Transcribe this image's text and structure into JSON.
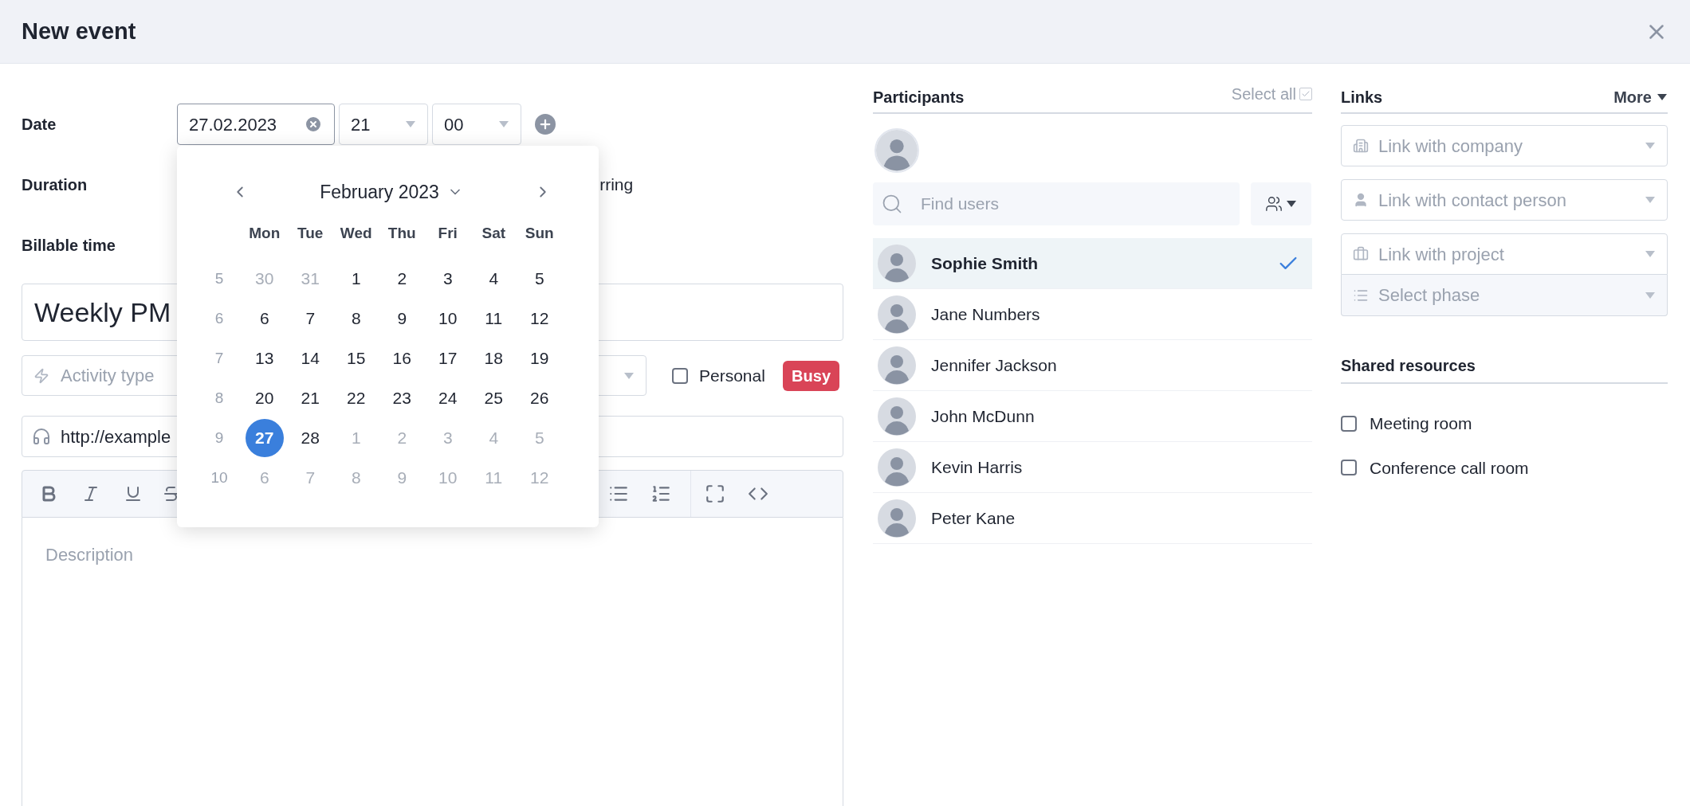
{
  "window": {
    "title": "New event"
  },
  "form": {
    "date_label": "Date",
    "date_value": "27.02.2023",
    "hour": "21",
    "minute": "00",
    "duration_label": "Duration",
    "recurring_fragment": "rring",
    "billable_label": "Billable time",
    "title_value": "Weekly PM",
    "activity_placeholder": "Activity type",
    "personal": {
      "label": "Personal",
      "checked": false
    },
    "busy_badge": "Busy",
    "url_value": "http://example",
    "description_placeholder": "Description"
  },
  "calendar": {
    "month": "February 2023",
    "weekdays": [
      "Mon",
      "Tue",
      "Wed",
      "Thu",
      "Fri",
      "Sat",
      "Sun"
    ],
    "weeks": [
      {
        "number": "5",
        "days": [
          {
            "text": "30",
            "muted": true,
            "selected": false
          },
          {
            "text": "31",
            "muted": true,
            "selected": false
          },
          {
            "text": "1",
            "muted": false,
            "selected": false
          },
          {
            "text": "2",
            "muted": false,
            "selected": false
          },
          {
            "text": "3",
            "muted": false,
            "selected": false
          },
          {
            "text": "4",
            "muted": false,
            "selected": false
          },
          {
            "text": "5",
            "muted": false,
            "selected": false
          }
        ]
      },
      {
        "number": "6",
        "days": [
          {
            "text": "6",
            "muted": false,
            "selected": false
          },
          {
            "text": "7",
            "muted": false,
            "selected": false
          },
          {
            "text": "8",
            "muted": false,
            "selected": false
          },
          {
            "text": "9",
            "muted": false,
            "selected": false
          },
          {
            "text": "10",
            "muted": false,
            "selected": false
          },
          {
            "text": "11",
            "muted": false,
            "selected": false
          },
          {
            "text": "12",
            "muted": false,
            "selected": false
          }
        ]
      },
      {
        "number": "7",
        "days": [
          {
            "text": "13",
            "muted": false,
            "selected": false
          },
          {
            "text": "14",
            "muted": false,
            "selected": false
          },
          {
            "text": "15",
            "muted": false,
            "selected": false
          },
          {
            "text": "16",
            "muted": false,
            "selected": false
          },
          {
            "text": "17",
            "muted": false,
            "selected": false
          },
          {
            "text": "18",
            "muted": false,
            "selected": false
          },
          {
            "text": "19",
            "muted": false,
            "selected": false
          }
        ]
      },
      {
        "number": "8",
        "days": [
          {
            "text": "20",
            "muted": false,
            "selected": false
          },
          {
            "text": "21",
            "muted": false,
            "selected": false
          },
          {
            "text": "22",
            "muted": false,
            "selected": false
          },
          {
            "text": "23",
            "muted": false,
            "selected": false
          },
          {
            "text": "24",
            "muted": false,
            "selected": false
          },
          {
            "text": "25",
            "muted": false,
            "selected": false
          },
          {
            "text": "26",
            "muted": false,
            "selected": false
          }
        ]
      },
      {
        "number": "9",
        "days": [
          {
            "text": "27",
            "muted": false,
            "selected": true
          },
          {
            "text": "28",
            "muted": false,
            "selected": false
          },
          {
            "text": "1",
            "muted": true,
            "selected": false
          },
          {
            "text": "2",
            "muted": true,
            "selected": false
          },
          {
            "text": "3",
            "muted": true,
            "selected": false
          },
          {
            "text": "4",
            "muted": true,
            "selected": false
          },
          {
            "text": "5",
            "muted": true,
            "selected": false
          }
        ]
      },
      {
        "number": "10",
        "days": [
          {
            "text": "6",
            "muted": true,
            "selected": false
          },
          {
            "text": "7",
            "muted": true,
            "selected": false
          },
          {
            "text": "8",
            "muted": true,
            "selected": false
          },
          {
            "text": "9",
            "muted": true,
            "selected": false
          },
          {
            "text": "10",
            "muted": true,
            "selected": false
          },
          {
            "text": "11",
            "muted": true,
            "selected": false
          },
          {
            "text": "12",
            "muted": true,
            "selected": false
          }
        ]
      }
    ]
  },
  "participants": {
    "title": "Participants",
    "select_all": {
      "label": "Select all",
      "checked": true
    },
    "search_placeholder": "Find users",
    "users": [
      {
        "name": "Sophie Smith",
        "selected": true
      },
      {
        "name": "Jane Numbers",
        "selected": false
      },
      {
        "name": "Jennifer Jackson",
        "selected": false
      },
      {
        "name": "John McDunn",
        "selected": false
      },
      {
        "name": "Kevin Harris",
        "selected": false
      },
      {
        "name": "Peter Kane",
        "selected": false
      }
    ]
  },
  "links": {
    "title": "Links",
    "more": "More",
    "fields": [
      {
        "kind": "company",
        "placeholder": "Link with company"
      },
      {
        "kind": "contact",
        "placeholder": "Link with contact person"
      },
      {
        "kind": "project",
        "placeholder": "Link with project"
      },
      {
        "kind": "phase",
        "placeholder": "Select phase"
      }
    ]
  },
  "shared_resources": {
    "title": "Shared resources",
    "items": [
      {
        "label": "Meeting room",
        "checked": false
      },
      {
        "label": "Conference call room",
        "checked": false
      }
    ]
  }
}
